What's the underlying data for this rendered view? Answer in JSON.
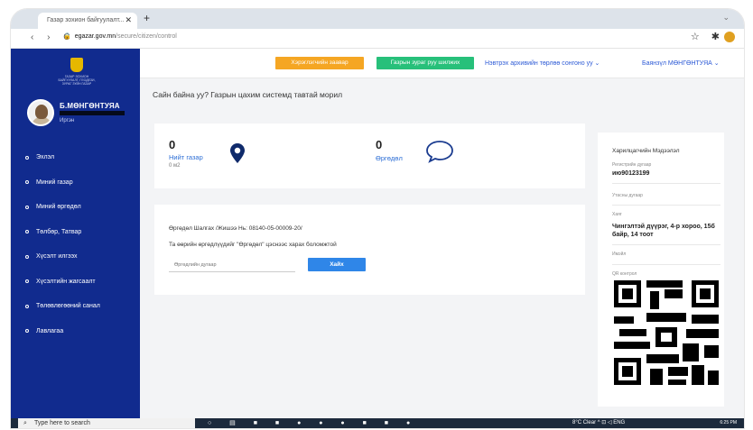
{
  "browser": {
    "tab_title": "Газар зохион байгуулалт...",
    "new_tab": "+",
    "tab_close": "✕",
    "url_host": "egazar.gov.mn",
    "url_path": "/secure/citizen/control",
    "nav_icons": "‹ › C",
    "right_icons": "☆ ✱"
  },
  "sidebar": {
    "logo_text": "ГАЗАР ЗОХИОН БАЙГУУЛАЛТ, ГЕОДЕЗИ, ЗУРАГ ЗҮЙН ГАЗАР",
    "user_name": "Б.МӨНГӨНТУЯА",
    "user_role": "Иргэн",
    "items": [
      {
        "label": "Эхлэл"
      },
      {
        "label": "Миний газар"
      },
      {
        "label": "Миний өргөдөл"
      },
      {
        "label": "Төлбөр, Татвар"
      },
      {
        "label": "Хүсэлт илгээх"
      },
      {
        "label": "Хүсэлтийн жагсаалт"
      },
      {
        "label": "Төлөвлөгөөний санал"
      },
      {
        "label": "Лавлагаа"
      }
    ]
  },
  "header": {
    "orange_button": "Хэрэглэгчийн заавар",
    "green_button": "Газрын зураг руу шилжих",
    "archive_link": "Нэвтрэх архивийн төрлөө сонгоно уу ⌄",
    "user_menu": "Баянзүл МӨНГӨНТУЯА ⌄"
  },
  "main": {
    "welcome": "Сайн байна уу? Газрын цахим системд тавтай морил",
    "stats": {
      "land_count": "0",
      "land_label": "Нийт газар",
      "land_area": "0 м2",
      "application_count": "0",
      "application_label": "Өргөдөл"
    },
    "search": {
      "title": "Өргөдөл Шалгах /Жишээ Нь: 08140-05-00009-20/",
      "hint": "Та өөрийн өргөдлүүдийг \"Өргөдөл\" цэснээс харах боломжтой",
      "placeholder": "Өргөдлийн дугаар",
      "button": "Хайх"
    }
  },
  "info_panel": {
    "title": "Харилцагчийн Мэдээлэл",
    "reg_label": "Регистрийн дугаар",
    "reg_value": "ию90123199",
    "phone_label": "Утасны дугаар",
    "phone_value": "",
    "address_label": "Хаяг",
    "address_value": "Чингэлтэй дүүрэг, 4-р хороо, 15б байр, 14 тоот",
    "email_label": "Имэйл",
    "qr_label": "QR контрол"
  },
  "taskbar": {
    "search_text": "Type here to search",
    "tray": "8°C Clear ^ ⊡ ◁ ENG",
    "clock": "6:25 PM"
  },
  "colors": {
    "sidebar_bg": "#112b8e",
    "orange": "#f5a623",
    "green": "#27c07a",
    "link_blue": "#2e5bd6",
    "primary_blue": "#2f86e8"
  }
}
